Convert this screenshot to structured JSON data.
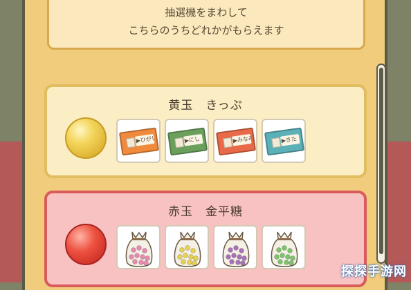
{
  "notice": {
    "line1": "抽選機をまわして",
    "line2": "こちらのうちどれかがもらえます"
  },
  "cards": [
    {
      "title": "黄玉　きっぷ",
      "ball_color": "#f3d65c",
      "items": [
        {
          "label": "▶ひがし",
          "color": "#f08a3c"
        },
        {
          "label": "▶にし",
          "color": "#6aa05c"
        },
        {
          "label": "▶みなみ",
          "color": "#e86a48"
        },
        {
          "label": "▶きた",
          "color": "#5cb0b8"
        }
      ]
    },
    {
      "title": "赤玉　金平糖",
      "ball_color": "#ee5240",
      "items": [
        {
          "label": "pink-konpeito",
          "color": "#e88ab0"
        },
        {
          "label": "yellow-konpeito",
          "color": "#e8d050"
        },
        {
          "label": "purple-konpeito",
          "color": "#a872b8"
        },
        {
          "label": "green-konpeito",
          "color": "#7cc46c"
        }
      ]
    }
  ],
  "watermark": "探探手游网"
}
